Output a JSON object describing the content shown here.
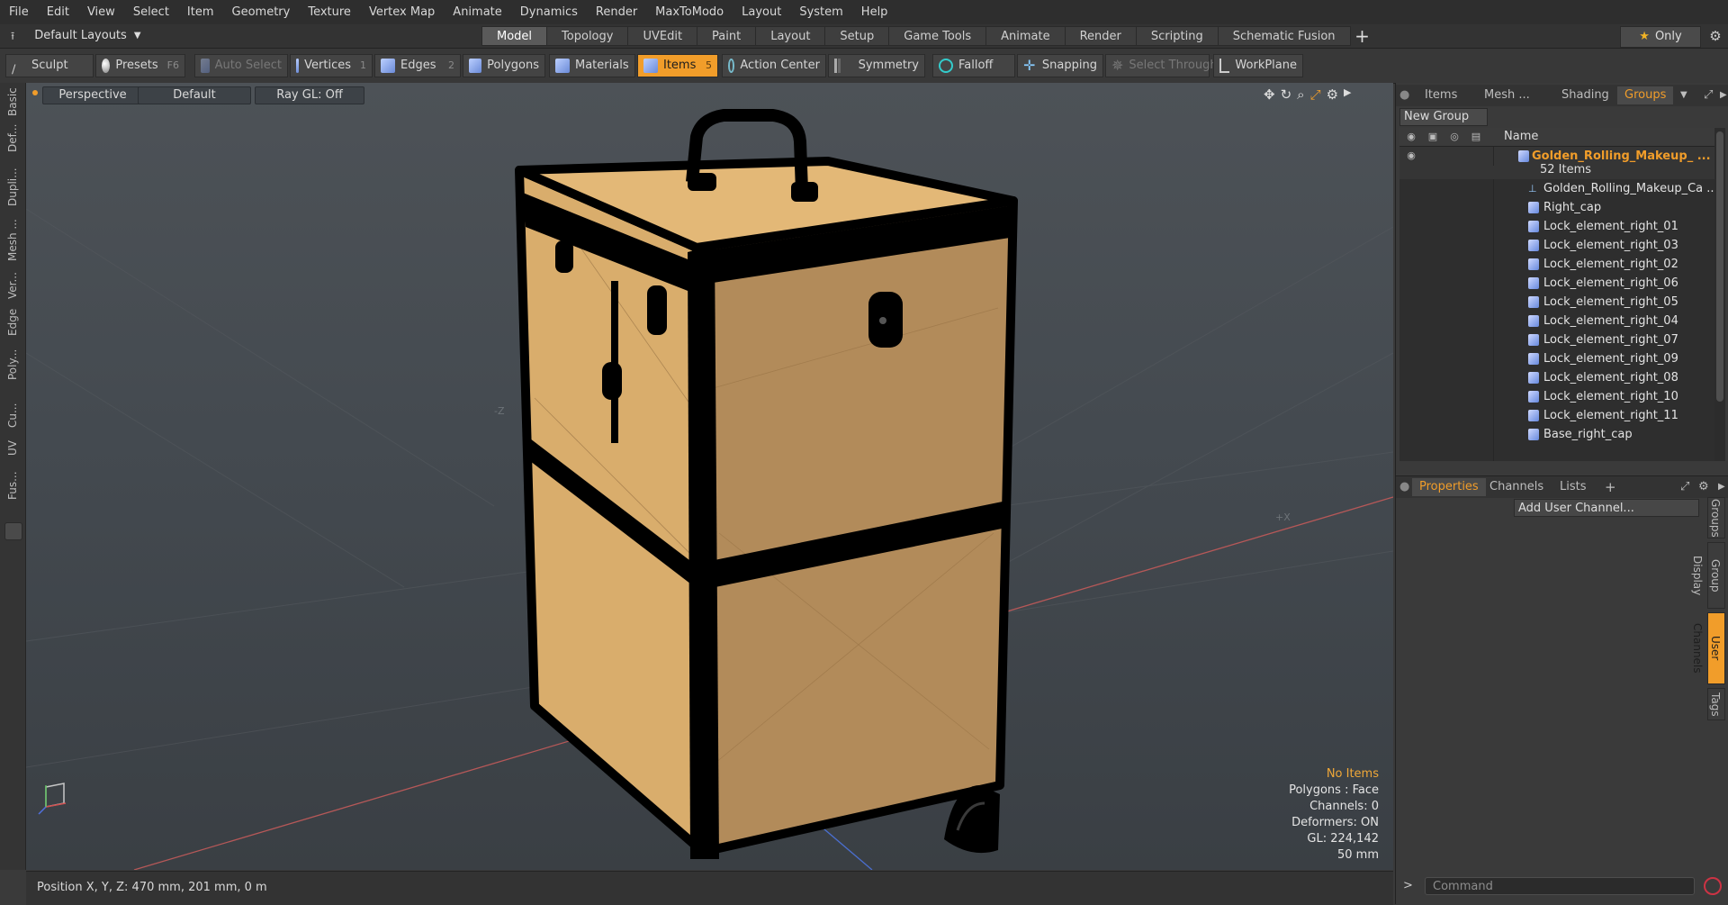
{
  "menubar": {
    "items": [
      "File",
      "Edit",
      "View",
      "Select",
      "Item",
      "Geometry",
      "Texture",
      "Vertex Map",
      "Animate",
      "Dynamics",
      "Render",
      "MaxToModo",
      "Layout",
      "System",
      "Help"
    ]
  },
  "layoutbar": {
    "layout_dropdown": "Default Layouts",
    "tabs": [
      "Model",
      "Topology",
      "UVEdit",
      "Paint",
      "Layout",
      "Setup",
      "Game Tools",
      "Animate",
      "Render",
      "Scripting",
      "Schematic Fusion"
    ],
    "active_tab": "Model",
    "only_label": "Only"
  },
  "toolbar": {
    "sculpt": "Sculpt",
    "presets": "Presets",
    "presets_key": "F6",
    "auto_select": "Auto Select",
    "vertices": "Vertices",
    "vertices_key": "1",
    "edges": "Edges",
    "edges_key": "2",
    "polygons": "Polygons",
    "materials": "Materials",
    "items": "Items",
    "items_key": "5",
    "action_center": "Action Center",
    "symmetry": "Symmetry",
    "falloff": "Falloff",
    "snapping": "Snapping",
    "select_through": "Select Through",
    "workplane": "WorkPlane"
  },
  "left_tabs": [
    "Basic",
    "Def...",
    "Dupli...",
    "Mesh ...",
    "Ver...",
    "Edge",
    "Poly...",
    "Cu...",
    "UV",
    "Fus..."
  ],
  "viewport": {
    "view_mode": "Perspective",
    "shading": "Default",
    "raygl": "Ray GL: Off",
    "axis_neg_z": "-Z",
    "axis_pos_x": "+X",
    "info": {
      "no_items": "No Items",
      "polygons": "Polygons : Face",
      "channels": "Channels: 0",
      "deformers": "Deformers: ON",
      "gl": "GL: 224,142",
      "scale": "50 mm"
    }
  },
  "status": {
    "position": "Position X, Y, Z:  470 mm, 201 mm, 0 m"
  },
  "right_panel": {
    "tabs": [
      "Items",
      "Mesh ...",
      "Shading",
      "Groups"
    ],
    "active_tab": "Groups",
    "new_group": "New Group",
    "name_header": "Name",
    "group_name": "Golden_Rolling_Makeup_ ...",
    "group_count": "52 Items",
    "items": [
      "Golden_Rolling_Makeup_Ca ...",
      "Right_cap",
      "Lock_element_right_01",
      "Lock_element_right_03",
      "Lock_element_right_02",
      "Lock_element_right_06",
      "Lock_element_right_05",
      "Lock_element_right_04",
      "Lock_element_right_07",
      "Lock_element_right_09",
      "Lock_element_right_08",
      "Lock_element_right_10",
      "Lock_element_right_11",
      "Base_right_cap"
    ],
    "prop_tabs": [
      "Properties",
      "Channels",
      "Lists"
    ],
    "prop_active": "Properties",
    "add_user_channel": "Add User Channel...",
    "side_tabs": [
      "Groups",
      "Group Display",
      "User Channels",
      "Tags"
    ],
    "side_active": "User Channels",
    "command_placeholder": "Command",
    "command_prompt": ">"
  },
  "colors": {
    "accent": "#f19d2a",
    "case_body": "#d6a968",
    "case_frame": "#000000"
  }
}
